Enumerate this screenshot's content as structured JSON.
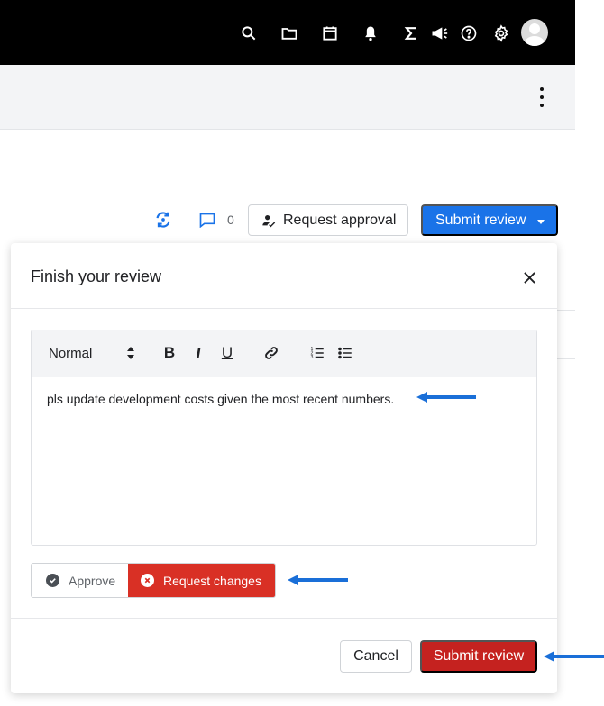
{
  "topbar": {
    "icons": [
      "search-icon",
      "folder-icon",
      "calendar-icon",
      "bell-icon",
      "sigma-icon",
      "megaphone-icon",
      "help-icon",
      "gear-icon"
    ]
  },
  "action_bar": {
    "comment_count": "0",
    "request_approval_label": "Request approval",
    "submit_review_label": "Submit review"
  },
  "modal": {
    "title": "Finish your review",
    "editor": {
      "format_value": "Normal",
      "bold_label": "B",
      "italic_label": "I",
      "underline_label": "U",
      "body_text": "pls update development costs given the most recent numbers."
    },
    "decision": {
      "approve_label": "Approve",
      "request_changes_label": "Request changes",
      "selected": "Request changes"
    },
    "footer": {
      "cancel_label": "Cancel",
      "submit_label": "Submit review"
    }
  },
  "colors": {
    "primary_blue": "#1a73e8",
    "danger_red": "#d93025",
    "annotation_arrow": "#1a6fd8"
  }
}
